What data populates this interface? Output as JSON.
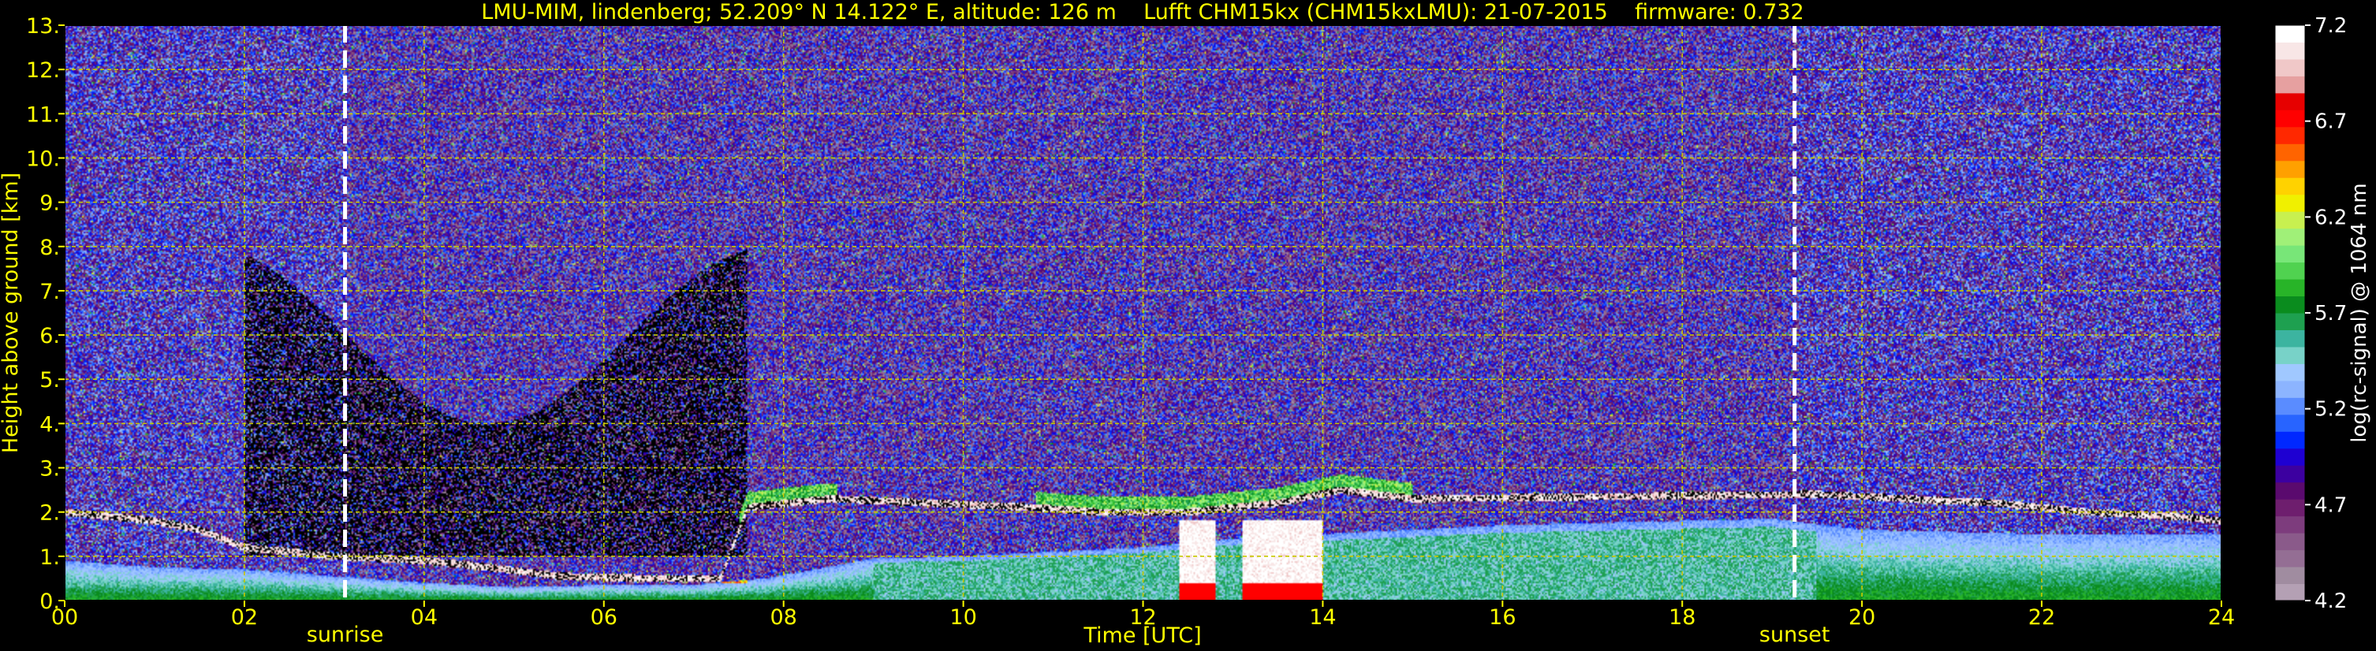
{
  "chart_data": {
    "type": "heatmap",
    "title": "LMU-MIM, lindenberg; 52.209° N 14.122° E, altitude: 126 m    Lufft CHM15kx (CHM15kxLMU): 21-07-2015    firmware: 0.732",
    "xlabel": "Time [UTC]",
    "ylabel": "Height above ground [km]",
    "xlim": [
      0,
      24
    ],
    "ylim": [
      0,
      13
    ],
    "x_ticks": [
      "00",
      "02",
      "04",
      "06",
      "08",
      "10",
      "12",
      "14",
      "16",
      "18",
      "20",
      "22",
      "24"
    ],
    "y_ticks": [
      "0.",
      "1.",
      "2.",
      "3.",
      "4.",
      "5.",
      "6.",
      "7.",
      "8.",
      "9.",
      "10.",
      "11.",
      "12.",
      "13."
    ],
    "grid": true,
    "colorbar": {
      "label": "log(rc-signal) @ 1064 nm",
      "range": [
        4.2,
        7.2
      ],
      "ticks": [
        "4.2",
        "4.7",
        "5.2",
        "5.7",
        "6.2",
        "6.7",
        "7.2"
      ],
      "colors": [
        "#b4a0b4",
        "#a08ca0",
        "#946e94",
        "#8a5a8a",
        "#7d3c7d",
        "#6e1e6e",
        "#5a0a6e",
        "#3c00a0",
        "#1e00d2",
        "#0028ff",
        "#2864ff",
        "#5a8cff",
        "#8cb4ff",
        "#a0c8ff",
        "#78d2c8",
        "#3cb4a0",
        "#1ea050",
        "#0a8c1e",
        "#28b428",
        "#50d250",
        "#78e678",
        "#a0f078",
        "#c8f050",
        "#f0f000",
        "#ffd200",
        "#ffa000",
        "#ff6400",
        "#ff2800",
        "#ff0000",
        "#e60000",
        "#e6a0a0",
        "#f0c8c8",
        "#f8e6e6",
        "#ffffff"
      ]
    },
    "annotations": [
      {
        "text": "sunrise",
        "x": 3.12
      },
      {
        "text": "sunset",
        "x": 19.25
      }
    ],
    "features": {
      "boundary_layer": [
        [
          0,
          0.9
        ],
        [
          1,
          0.75
        ],
        [
          2,
          0.7
        ],
        [
          3,
          0.55
        ],
        [
          4,
          0.4
        ],
        [
          5,
          0.3
        ],
        [
          6,
          0.35
        ],
        [
          7,
          0.35
        ],
        [
          7.8,
          0.5
        ],
        [
          9,
          0.95
        ],
        [
          10,
          1.0
        ],
        [
          11,
          1.1
        ],
        [
          12,
          1.2
        ],
        [
          13,
          1.4
        ],
        [
          14,
          1.5
        ],
        [
          15,
          1.6
        ],
        [
          16,
          1.7
        ],
        [
          17,
          1.75
        ],
        [
          18,
          1.8
        ],
        [
          19,
          1.85
        ],
        [
          20,
          1.6
        ],
        [
          21,
          1.55
        ],
        [
          22,
          1.5
        ],
        [
          23,
          1.5
        ],
        [
          24,
          1.5
        ]
      ],
      "cloud_base": [
        [
          0,
          2.0
        ],
        [
          1,
          1.8
        ],
        [
          1.5,
          1.6
        ],
        [
          2,
          1.2
        ],
        [
          3,
          1.0
        ],
        [
          4,
          0.9
        ],
        [
          4.5,
          0.8
        ],
        [
          5.5,
          0.55
        ],
        [
          6.5,
          0.5
        ],
        [
          7.3,
          0.5
        ],
        [
          7.6,
          2.1
        ],
        [
          8.5,
          2.3
        ],
        [
          10.8,
          2.1
        ],
        [
          11.5,
          2.0
        ],
        [
          12.5,
          2.0
        ],
        [
          13.5,
          2.2
        ],
        [
          14.2,
          2.5
        ],
        [
          15,
          2.3
        ],
        [
          19.5,
          2.4
        ],
        [
          20.5,
          2.3
        ],
        [
          21.5,
          2.2
        ],
        [
          22.5,
          2.0
        ],
        [
          23.5,
          1.9
        ],
        [
          24,
          1.8
        ]
      ],
      "precipitation": [
        [
          12.4,
          12.8
        ],
        [
          13.1,
          14.0
        ]
      ]
    }
  }
}
